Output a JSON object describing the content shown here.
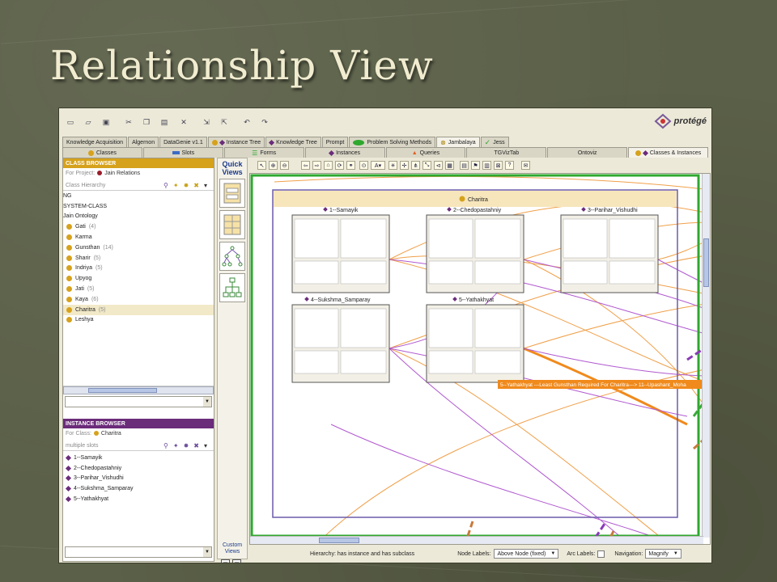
{
  "slide": {
    "title": "Relationship View"
  },
  "app": {
    "brand": "protégé",
    "tabs": [
      {
        "label": "Knowledge Acquisition"
      },
      {
        "label": "Algernon"
      },
      {
        "label": "DataGenie v1.1"
      },
      {
        "label": "Instance Tree"
      },
      {
        "label": "Knowledge Tree"
      },
      {
        "label": "Prompt"
      },
      {
        "label": "Problem Solving Methods"
      },
      {
        "label": "Jambalaya"
      },
      {
        "label": "Jess"
      }
    ],
    "tabs2": [
      {
        "label": "Classes"
      },
      {
        "label": "Slots"
      },
      {
        "label": "Forms"
      },
      {
        "label": "Instances"
      },
      {
        "label": "Queries"
      },
      {
        "label": "TGVizTab"
      },
      {
        "label": "Ontoviz"
      },
      {
        "label": "Classes & Instances"
      }
    ],
    "colors": {
      "class_dot": "#d6a21c",
      "instance_diamond": "#6b2c7a",
      "class_header": "#d6a21c",
      "instance_header": "#6b2c7a"
    }
  },
  "class_browser": {
    "header": "CLASS BROWSER",
    "for_project_label": "For Project:",
    "project_name": "Jain Relations",
    "hierarchy_label": "Class Hierarchy",
    "root_items": [
      "NG",
      "SYSTEM-CLASS",
      "Jain Ontology"
    ],
    "classes": [
      {
        "name": "Gati",
        "count": "(4)"
      },
      {
        "name": "Karma",
        "count": ""
      },
      {
        "name": "Gunsthan",
        "count": "(14)"
      },
      {
        "name": "Sharir",
        "count": "(5)"
      },
      {
        "name": "Indriya",
        "count": "(5)"
      },
      {
        "name": "Upyog",
        "count": ""
      },
      {
        "name": "Jati",
        "count": "(5)"
      },
      {
        "name": "Kaya",
        "count": "(6)"
      },
      {
        "name": "Charitra",
        "count": "(5)"
      },
      {
        "name": "Leshya",
        "count": ""
      }
    ]
  },
  "instance_browser": {
    "header": "INSTANCE BROWSER",
    "for_class_label": "For Class:",
    "class_name": "Charitra",
    "slots_label": "multiple slots",
    "instances": [
      "1--Samayik",
      "2--Chedopastahniy",
      "3--Parihar_Vishudhi",
      "4--Sukshma_Samparay",
      "5--Yathakhyat"
    ]
  },
  "quick_views": {
    "title": "Quick Views",
    "custom_title": "Custom Views"
  },
  "canvas": {
    "group_title": "Charitra",
    "nodes": [
      "1--Samayik",
      "2--Chedopastahniy",
      "3--Parihar_Vishudhi",
      "4--Sukshma_Samparay",
      "5--Yathakhyat"
    ],
    "tooltip": "5--Yathakhyat ---Least Gunsthan Required For Charitra---> 11--Upashant_Moha"
  },
  "status": {
    "hierarchy": "Hierarchy: has instance and has subclass",
    "node_labels_label": "Node Labels:",
    "node_labels_value": "Above Node (fixed)",
    "arc_labels_label": "Arc Labels:",
    "navigation_label": "Navigation:",
    "navigation_value": "Magnify"
  }
}
